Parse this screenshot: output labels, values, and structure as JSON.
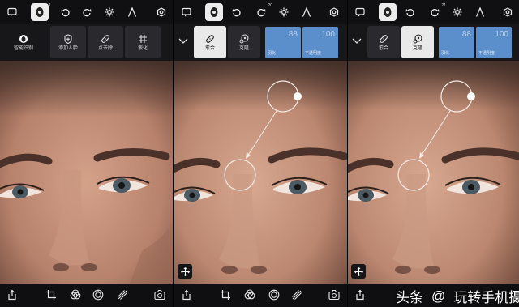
{
  "panels": [
    {
      "top_icons": [
        "message-icon",
        "face-mask-icon",
        "undo-icon",
        "redo-icon",
        "gear-icon",
        "text-icon",
        "settings-icon"
      ],
      "redo_badge": "",
      "tools": [
        {
          "label": "智能识别",
          "icon": "face-scan-icon"
        },
        {
          "label": "添加人脸",
          "icon": "add-face-icon"
        },
        {
          "label": "点去除",
          "icon": "bandage-icon"
        },
        {
          "label": "液化",
          "icon": "grid-icon"
        }
      ]
    },
    {
      "top_icons": [
        "message-icon",
        "face-mask-icon",
        "undo-icon",
        "redo-icon",
        "gear-icon",
        "text-icon",
        "settings-icon"
      ],
      "redo_badge": "20",
      "tools": [
        {
          "label": "愈合",
          "icon": "bandage-icon"
        },
        {
          "label": "克隆",
          "icon": "clone-stamp-icon"
        }
      ],
      "sliders": [
        {
          "label": "羽化",
          "value": "88"
        },
        {
          "label": "不透明度",
          "value": "100"
        }
      ]
    },
    {
      "top_icons": [
        "message-icon",
        "face-mask-icon",
        "undo-icon",
        "redo-icon",
        "gear-icon",
        "text-icon",
        "settings-icon"
      ],
      "redo_badge": "21",
      "tools": [
        {
          "label": "愈合",
          "icon": "bandage-icon"
        },
        {
          "label": "克隆",
          "icon": "clone-stamp-icon"
        }
      ],
      "sliders": [
        {
          "label": "羽化",
          "value": "88"
        },
        {
          "label": "不透明度",
          "value": "100"
        }
      ]
    }
  ],
  "bottom_icons": [
    "export-icon",
    "crop-icon",
    "filter-icon",
    "healing-icon",
    "brush-icon",
    "camera-icon"
  ],
  "watermark": {
    "prefix": "头条",
    "at": "@",
    "name": "玩转手机摄影"
  },
  "colors": {
    "accent_blue": "#5b8fcb",
    "bar_dark": "#101012",
    "tool_selected": "#e9e9e9"
  }
}
